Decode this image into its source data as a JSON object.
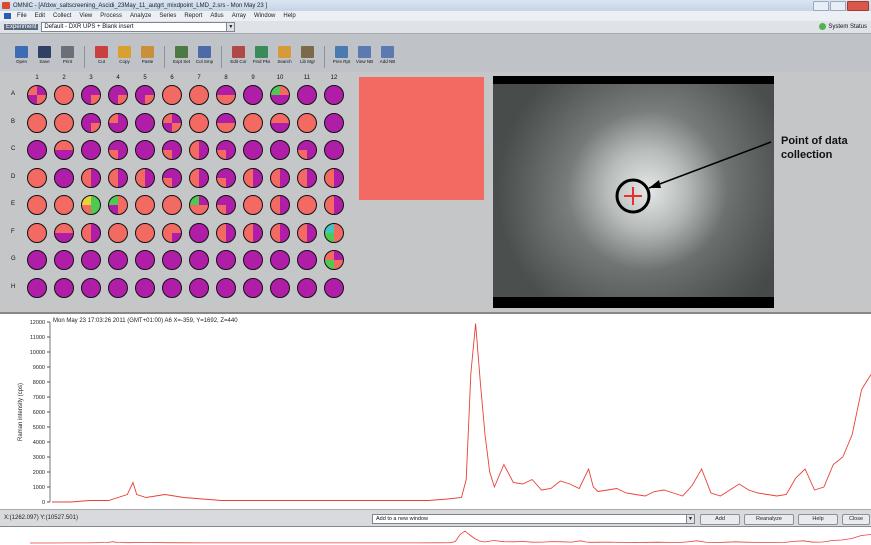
{
  "window": {
    "title": "OMNIC - [Afdxw_saltscreening_Ascidi_23May_11_autgrt_mixdpoint_LMD_2.srs - Mon May 23 ]",
    "controls": [
      "minimize",
      "restore",
      "close"
    ]
  },
  "menu": {
    "items": [
      "File",
      "Edit",
      "Collect",
      "View",
      "Process",
      "Analyze",
      "Series",
      "Report",
      "Atlus",
      "Array",
      "Window",
      "Help"
    ]
  },
  "experiment": {
    "label": "Experiment",
    "value": "Default - DXR UPS + Blank insert",
    "status": "System Status"
  },
  "toolbar": {
    "groups": [
      [
        {
          "label": "Open",
          "icon": "open-icon",
          "color": "#3b6cb4"
        },
        {
          "label": "Save",
          "icon": "save-icon",
          "color": "#2f3f66"
        },
        {
          "label": "Print",
          "icon": "print-icon",
          "color": "#6a6f78"
        }
      ],
      [
        {
          "label": "Cut",
          "icon": "cut-icon",
          "color": "#c94040"
        },
        {
          "label": "Copy",
          "icon": "copy-icon",
          "color": "#d8a030"
        },
        {
          "label": "Paste",
          "icon": "paste-icon",
          "color": "#c8903a"
        }
      ],
      [
        {
          "label": "Expt Set",
          "icon": "expt-set-icon",
          "color": "#4c7a42"
        },
        {
          "label": "Col Smp",
          "icon": "collect-sample-icon",
          "color": "#4a6aa8"
        }
      ],
      [
        {
          "label": "Edit Cor",
          "icon": "edit-correction-icon",
          "color": "#b04848"
        },
        {
          "label": "Find Pks",
          "icon": "find-peaks-icon",
          "color": "#3a8a5a"
        },
        {
          "label": "Search",
          "icon": "search-icon",
          "color": "#d59b3a"
        },
        {
          "label": "Lib Mgr",
          "icon": "library-manager-icon",
          "color": "#7a6a4a"
        }
      ],
      [
        {
          "label": "Prev Rpt",
          "icon": "preview-report-icon",
          "color": "#4a7ab0"
        },
        {
          "label": "View NB",
          "icon": "view-notebook-icon",
          "color": "#5a7ab0"
        },
        {
          "label": "Add NB",
          "icon": "add-notebook-icon",
          "color": "#5a7ab0"
        }
      ]
    ]
  },
  "wellplate": {
    "columns": [
      "1",
      "2",
      "3",
      "4",
      "5",
      "6",
      "7",
      "8",
      "9",
      "10",
      "11",
      "12"
    ],
    "rows": [
      "A",
      "B",
      "C",
      "D",
      "E",
      "F",
      "G",
      "H"
    ],
    "palette": {
      "o": "#f26a62",
      "m": "#b01ea8",
      "y": "#e8d23a",
      "g": "#4fc94f",
      "c": "#3fc7c0",
      "k": "#1a1a1a"
    },
    "wells": [
      [
        "ommo",
        "oooo",
        "mmmo",
        "mmmo",
        "mmmo",
        "oooo",
        "oooo",
        "mmoo",
        "mmmm",
        "gomm",
        "mmmm",
        "mmmm"
      ],
      [
        "oooo",
        "oooo",
        "mmmo",
        "ommm",
        "mmmm",
        "ommo",
        "oooo",
        "mmoo",
        "oooo",
        "oomm",
        "oooo",
        "mmmm"
      ],
      [
        "mmmm",
        "oomm",
        "mmmm",
        "mmom",
        "mmmm",
        "mmom",
        "omom",
        "mmom",
        "mmmm",
        "mmmm",
        "mmom",
        "mmmm"
      ],
      [
        "oooo",
        "mmmm",
        "omom",
        "omom",
        "omom",
        "mmom",
        "omom",
        "mmom",
        "omom",
        "omom",
        "omom",
        "omom"
      ],
      [
        "oooo",
        "oooo",
        "ygog",
        "gomo",
        "oooo",
        "oooo",
        "gmoo",
        "mmom",
        "oooo",
        "omom",
        "oooo",
        "omom"
      ],
      [
        "oooo",
        "oomm",
        "omom",
        "oooo",
        "oooo",
        "ooom",
        "mmmm",
        "omom",
        "omom",
        "omom",
        "omom",
        "cogo"
      ],
      [
        "mmmm",
        "mmmm",
        "mmmm",
        "mmmm",
        "mmmm",
        "mmmm",
        "mmmm",
        "mmmm",
        "mmmm",
        "mmmm",
        "mmmm",
        "omgo"
      ],
      [
        "mmmm",
        "mmmm",
        "mmmm",
        "mmmm",
        "mmmm",
        "mmmm",
        "mmmm",
        "mmmm",
        "mmmm",
        "mmmm",
        "mmmm",
        "mmmm"
      ]
    ]
  },
  "selected_color": "#f26a62",
  "annotation": {
    "text_line1": "Point of data",
    "text_line2": "collection"
  },
  "spectrum": {
    "header": "Mon May 23 17:03:26 2011 (GMT+01:00)  A6  X=-359, Y=1692, Z=440",
    "ylabel": "Raman intensity (cps)",
    "yticks": [
      "12000",
      "11000",
      "10000",
      "9000",
      "8000",
      "7000",
      "6000",
      "5000",
      "4000",
      "3000",
      "2000",
      "1000",
      "0"
    ]
  },
  "chart_data": {
    "type": "line",
    "ylabel": "Raman intensity (cps)",
    "ylim": [
      0,
      12000
    ],
    "x": [
      0,
      20,
      40,
      60,
      80,
      86,
      90,
      100,
      120,
      140,
      160,
      180,
      200,
      220,
      240,
      260,
      280,
      300,
      320,
      340,
      360,
      380,
      400,
      420,
      435,
      440,
      445,
      450,
      455,
      460,
      465,
      470,
      480,
      490,
      500,
      510,
      520,
      530,
      540,
      550,
      560,
      570,
      575,
      580,
      590,
      600,
      610,
      620,
      630,
      640,
      650,
      660,
      670,
      680,
      690,
      700,
      710,
      720,
      730,
      740,
      750,
      760,
      770,
      780,
      790,
      800,
      810,
      820,
      830,
      840,
      850,
      860,
      870
    ],
    "series": [
      {
        "name": "",
        "values": [
          0,
          0,
          100,
          100,
          500,
          1300,
          500,
          300,
          500,
          300,
          200,
          100,
          100,
          100,
          100,
          100,
          100,
          100,
          100,
          100,
          100,
          100,
          100,
          200,
          300,
          1500,
          8600,
          11900,
          8000,
          4500,
          2000,
          1000,
          2500,
          1300,
          1200,
          1500,
          800,
          900,
          1400,
          1200,
          900,
          2200,
          1000,
          700,
          800,
          900,
          600,
          500,
          400,
          700,
          800,
          600,
          400,
          1100,
          2200,
          600,
          400,
          800,
          1200,
          800,
          600,
          500,
          400,
          500,
          1600,
          2200,
          800,
          1000,
          2500,
          3000,
          4500,
          7500,
          8500
        ]
      }
    ]
  },
  "bottom": {
    "coords": "X:(1262.097) Y:(10527.501)",
    "add_window": "Add to a new window",
    "buttons": [
      "Add",
      "Reanalyze",
      "Help",
      "Close"
    ]
  }
}
